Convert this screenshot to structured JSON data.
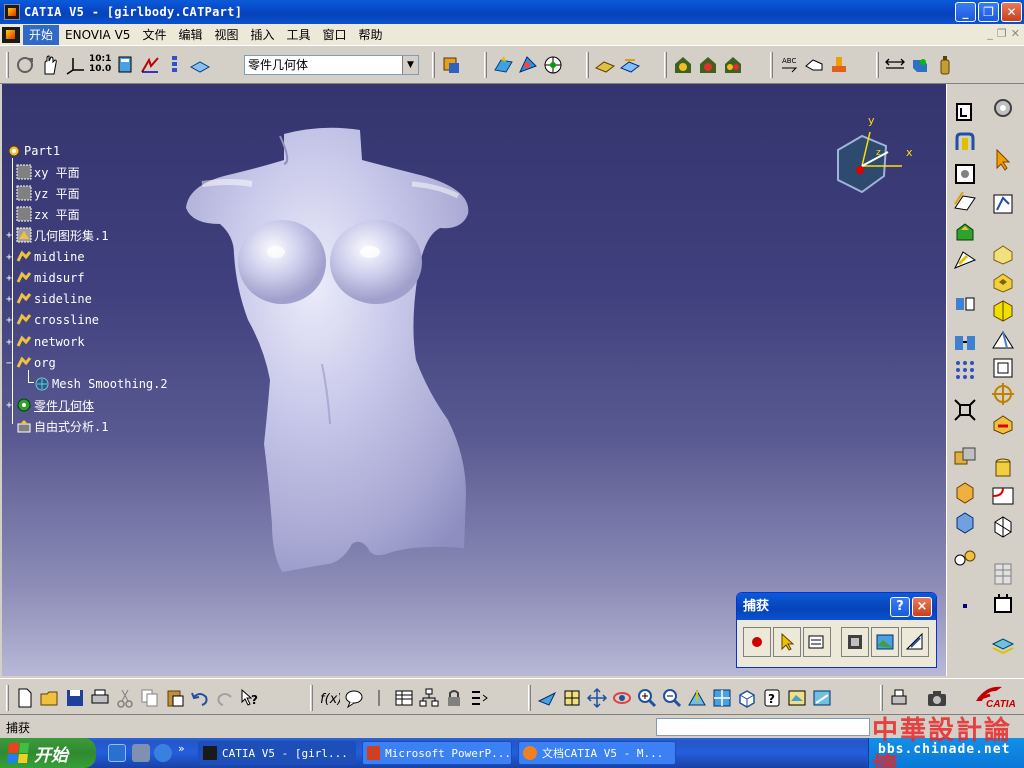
{
  "window": {
    "title": "CATIA V5 - [girlbody.CATPart]"
  },
  "menu": {
    "items": [
      "开始",
      "ENOVIA V5",
      "文件",
      "编辑",
      "视图",
      "插入",
      "工具",
      "窗口",
      "帮助"
    ]
  },
  "toolbar": {
    "body_selector_value": "零件几何体",
    "scale_label_top": "10:1",
    "scale_label_bottom": "10.0"
  },
  "tree": {
    "root": "Part1",
    "items": [
      {
        "label": "xy 平面"
      },
      {
        "label": "yz 平面"
      },
      {
        "label": "zx 平面"
      },
      {
        "label": "几何图形集.1"
      },
      {
        "label": "midline"
      },
      {
        "label": "midsurf"
      },
      {
        "label": "sideline"
      },
      {
        "label": "crossline"
      },
      {
        "label": "network"
      },
      {
        "label": "org"
      },
      {
        "label": "Mesh Smoothing.2"
      },
      {
        "label": "零件几何体"
      },
      {
        "label": "自由式分析.1"
      }
    ]
  },
  "compass": {
    "x_label": "x",
    "y_label": "y",
    "z_label": "z"
  },
  "dialog": {
    "title": "捕获",
    "help": "?",
    "close": "×"
  },
  "status": {
    "text": "捕获"
  },
  "taskbar": {
    "start": "开始",
    "tasks": [
      "CATIA V5 - [girl...",
      "Microsoft PowerP...",
      "文档CATIA V5 - M..."
    ]
  },
  "watermark": {
    "line1": "中華設計論壇",
    "line2": "bbs.chinade.net"
  },
  "logo": {
    "text": "CATIA"
  },
  "colors": {
    "viewport_top": "#34346e",
    "viewport_bottom": "#b8b8d6",
    "model": "#c8c8e8",
    "titlebar": "#0a5bd8"
  }
}
